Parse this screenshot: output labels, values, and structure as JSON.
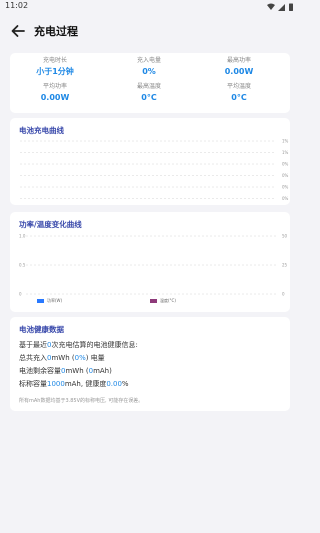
{
  "status_bar": {
    "time": "11:02"
  },
  "app_bar": {
    "title": "充电过程"
  },
  "stats": [
    {
      "label": "充电时长",
      "value": "小于1分钟"
    },
    {
      "label": "充入电量",
      "value": "0%"
    },
    {
      "label": "最高功率",
      "value": "0.00W"
    },
    {
      "label": "平均功率",
      "value": "0.00W"
    },
    {
      "label": "最高温度",
      "value": "0°C"
    },
    {
      "label": "平均温度",
      "value": "0°C"
    }
  ],
  "battery_chart": {
    "title": "电池充电曲线",
    "y_ticks": [
      "1%",
      "1%",
      "0%",
      "0%",
      "0%",
      "0%"
    ]
  },
  "power_temp_chart": {
    "title": "功率/温度变化曲线",
    "left_ticks": [
      "1.0",
      "0.5",
      "0"
    ],
    "right_ticks": [
      "50",
      "25",
      "0"
    ],
    "legend": [
      {
        "label": "功率(W)",
        "color": "#2979ff"
      },
      {
        "label": "温度(°C)",
        "color": "#8e3a7a"
      }
    ]
  },
  "health": {
    "title": "电池健康数据",
    "line1": {
      "pre": "基于最近",
      "count": "0",
      "post": "次充电估算的电池健康信息:"
    },
    "line2": {
      "pre": "总共充入",
      "value": "0",
      "mid": "mWh (",
      "pct": "0%",
      "post": ") 电量"
    },
    "line3": {
      "pre": "电池剩余容量",
      "value": "0",
      "mid": "mWh (",
      "value2": "0",
      "post": "mAh)"
    },
    "line4": {
      "pre": "标称容量",
      "value": "1000",
      "mid": "mAh, 健康度",
      "pct": "0.00",
      "post": "%"
    },
    "note": "所有mAh数据均基于3.85V的标称电压, 可能存在误差。"
  }
}
